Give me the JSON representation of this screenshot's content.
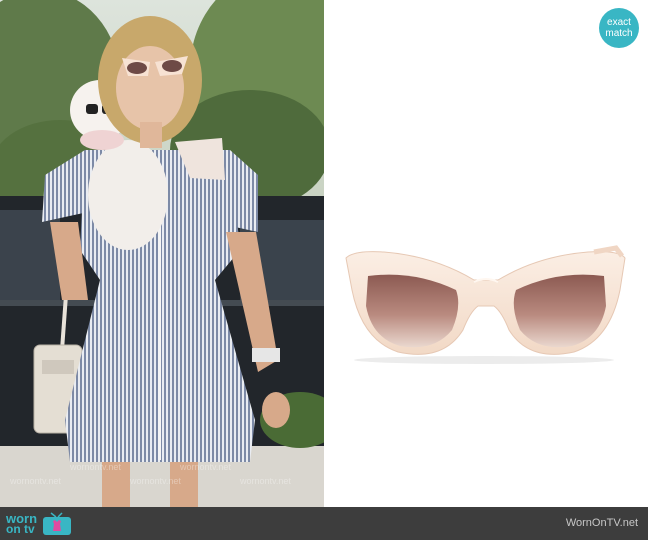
{
  "badge": {
    "line1": "exact",
    "line2": "match"
  },
  "footer": {
    "logo_worn": "worn",
    "logo_on_tv": "on tv",
    "site_url": "WornOnTV.net"
  },
  "colors": {
    "accent": "#39b6c4",
    "footer_bg": "#3d3d3d",
    "frame": "#f7e2d3",
    "lens": "#a0685d"
  },
  "watermark": {
    "text": "wornontv.net"
  }
}
